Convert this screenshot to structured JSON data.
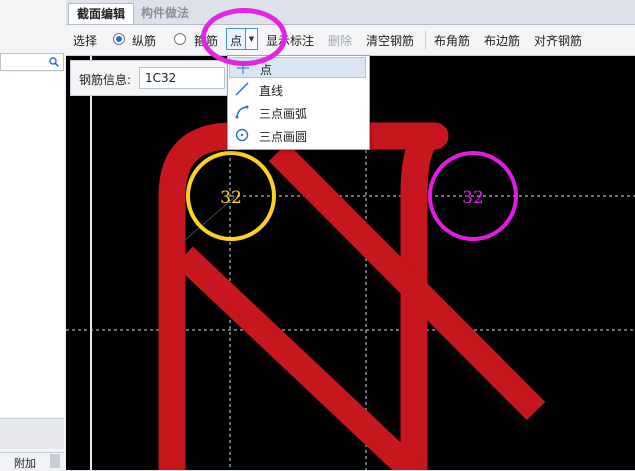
{
  "tabs": [
    {
      "label": "截面编辑",
      "active": true
    },
    {
      "label": "构件做法",
      "active": false
    }
  ],
  "toolbar": {
    "select_label": "选择",
    "radio_longitudinal": "纵筋",
    "radio_stirrup": "箍筋",
    "point_combo_value": "点",
    "show_annotation": "显示标注",
    "delete": "删除",
    "clear_rebar": "清空钢筋",
    "place_corner_rebar": "布角筋",
    "place_edge_rebar": "布边筋",
    "align_rebar": "对齐钢筋"
  },
  "info": {
    "label": "钢筋信息:",
    "value": "1C32"
  },
  "dropdown": {
    "items": [
      {
        "label": "点",
        "icon": "point-icon",
        "highlighted": true
      },
      {
        "label": "直线",
        "icon": "line-icon",
        "highlighted": false
      },
      {
        "label": "三点画弧",
        "icon": "arc-icon",
        "highlighted": false
      },
      {
        "label": "三点画圆",
        "icon": "circle-icon",
        "highlighted": false
      }
    ]
  },
  "canvas": {
    "rebar_left_label": "32",
    "rebar_right_label": "32",
    "colors": {
      "rebar": "#c8161e",
      "left_circle": "#ffd21f",
      "right_circle": "#e21ce2",
      "background": "#000000"
    }
  },
  "left_panel": {
    "tab_label": "附加"
  }
}
